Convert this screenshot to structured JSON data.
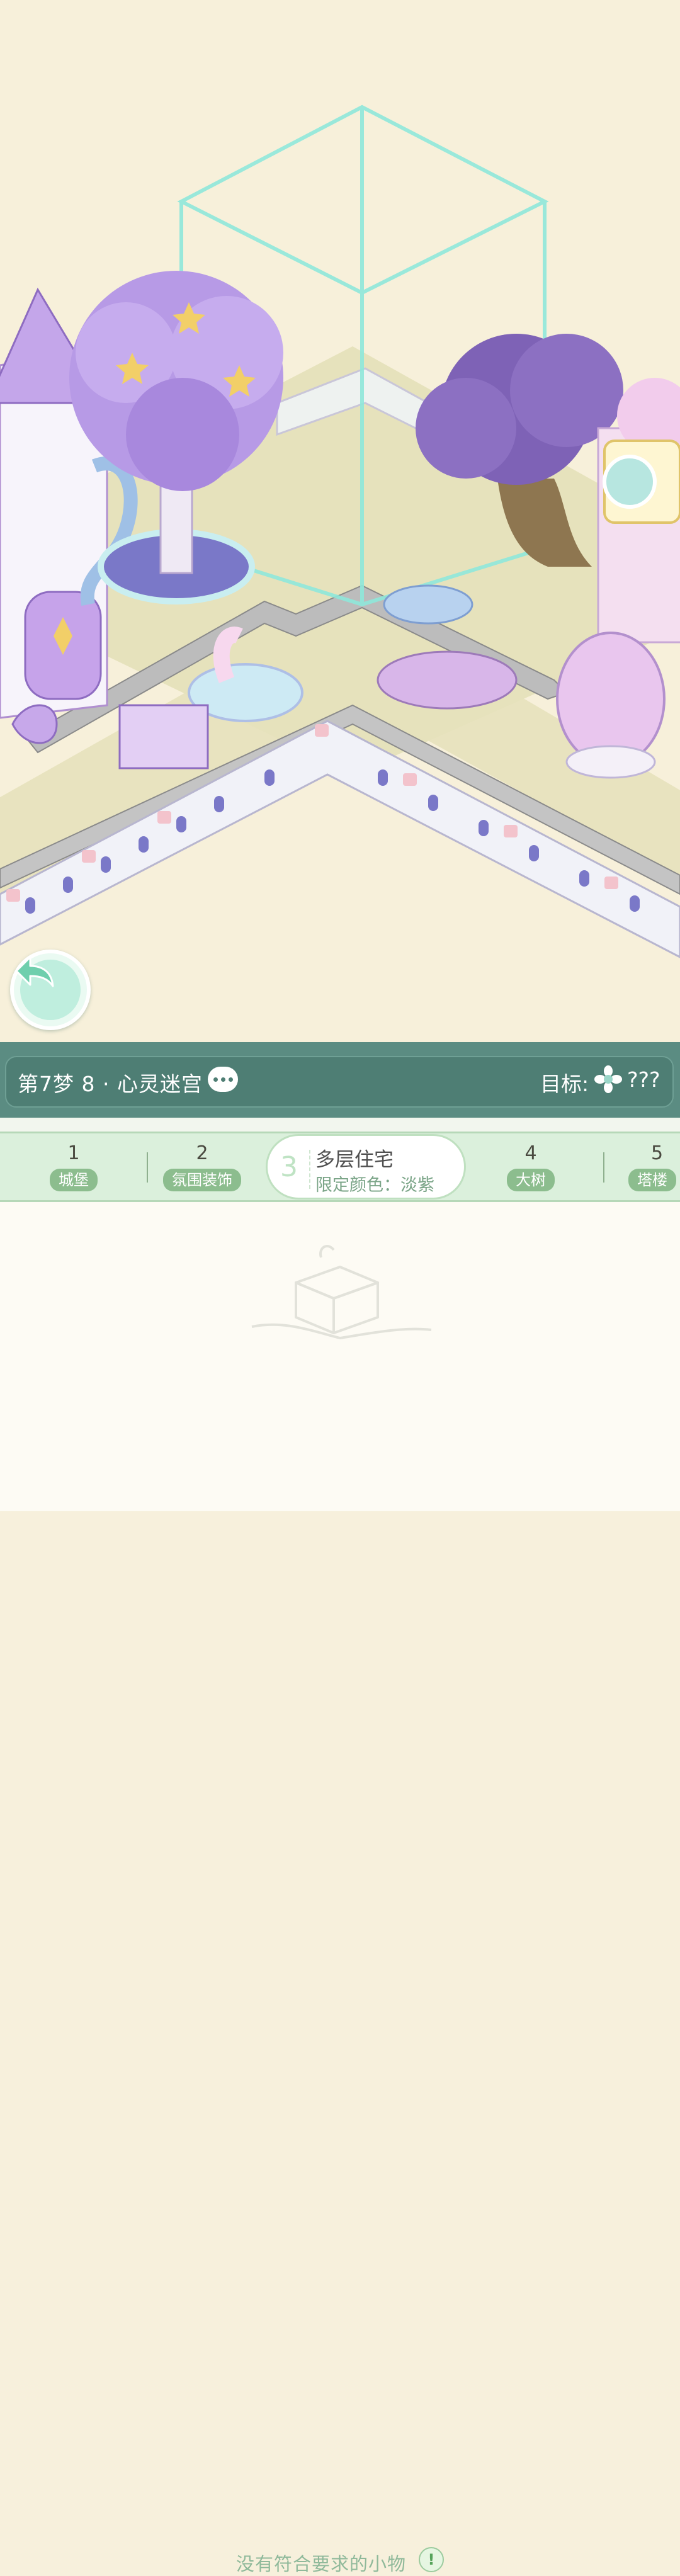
{
  "level": {
    "title": "第7梦 8 · 心灵迷宫",
    "target_label": "目标:",
    "target_value": "???"
  },
  "tabs": [
    {
      "num": "1",
      "category": "城堡"
    },
    {
      "num": "2",
      "category": "氛围装饰"
    },
    {
      "num": "3",
      "title": "多层住宅",
      "subtitle": "限定颜色：淡紫",
      "active": true
    },
    {
      "num": "4",
      "category": "大树"
    },
    {
      "num": "5",
      "category": "塔楼"
    }
  ],
  "empty_state": {
    "message": "没有符合要求的小物"
  },
  "colors": {
    "background": "#f7f0da",
    "info_bar": "#4e7e74",
    "tab_strip": "#dbf0dc",
    "accent_green": "#8cbd8e"
  },
  "icons": {
    "back": "back-arrow-icon",
    "chat": "chat-bubble-icon",
    "target": "sparkle-flower-icon",
    "alert": "exclamation-icon"
  }
}
